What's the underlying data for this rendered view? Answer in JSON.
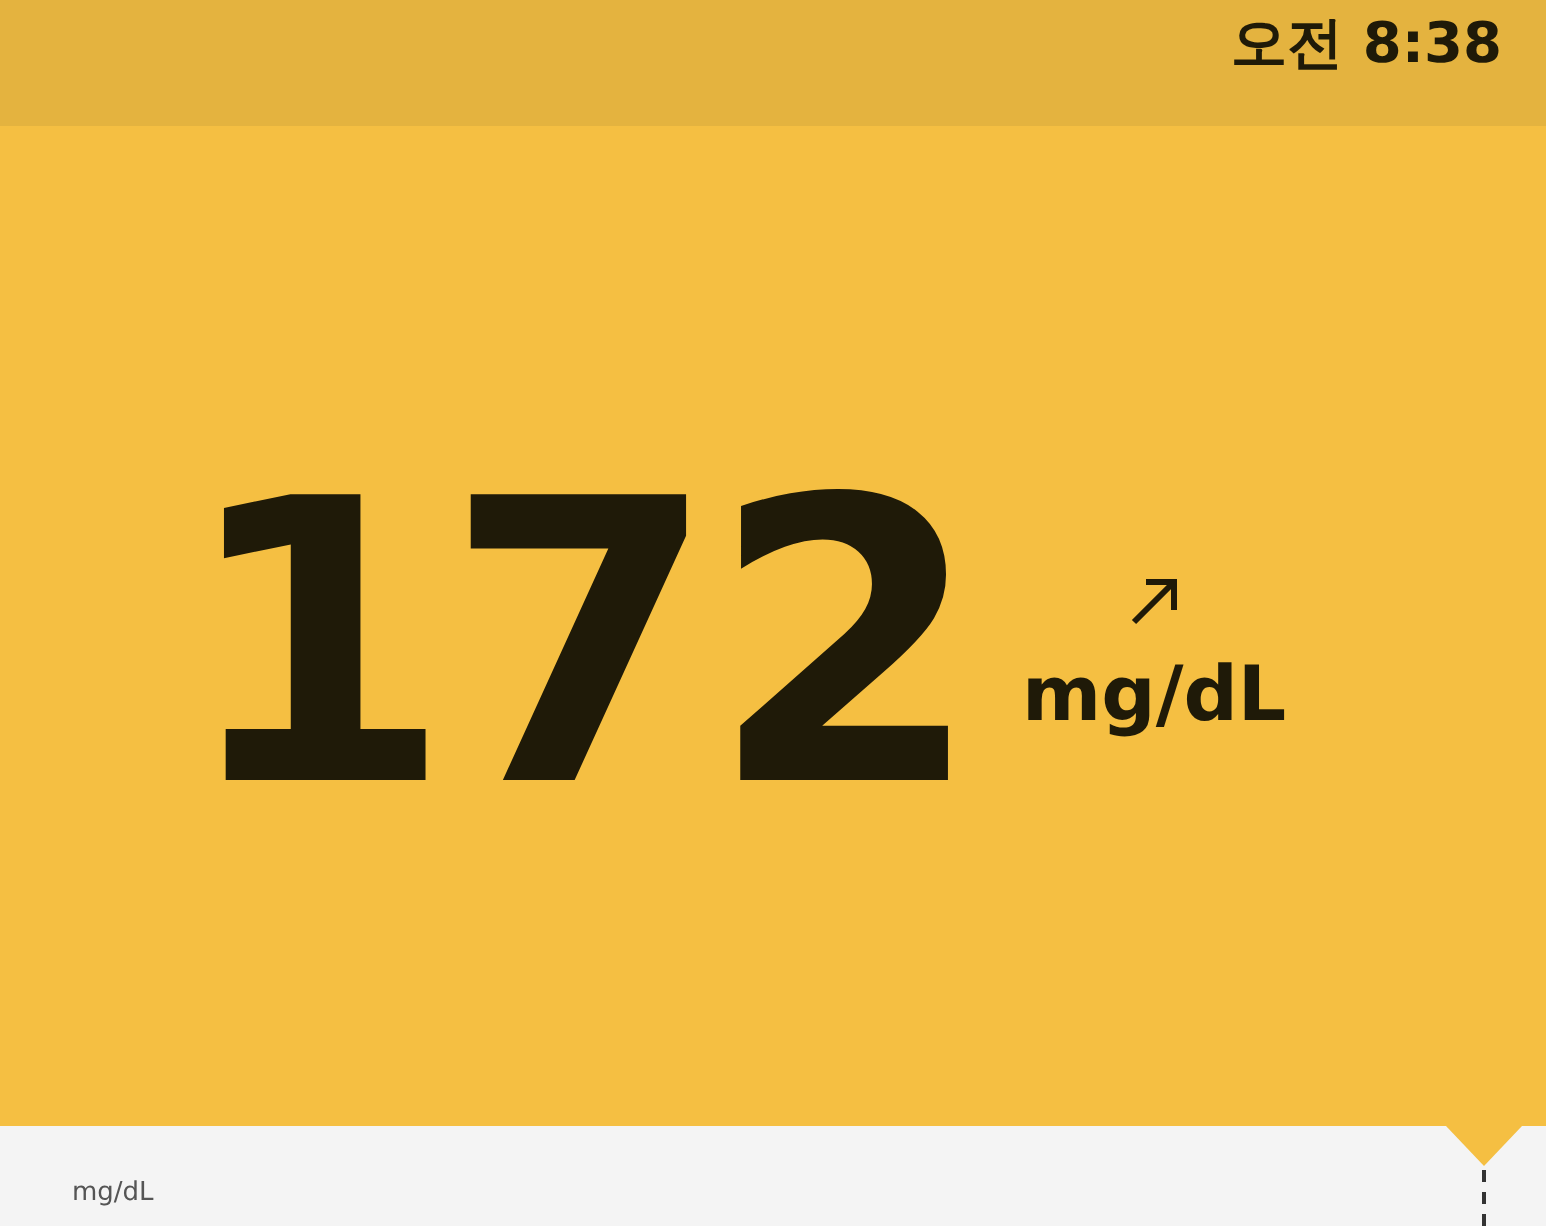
{
  "status_bar": {
    "time": "오전 8:38"
  },
  "reading": {
    "value": "172",
    "unit": "mg/dL"
  },
  "graph": {
    "axis_unit": "mg/dL"
  }
}
